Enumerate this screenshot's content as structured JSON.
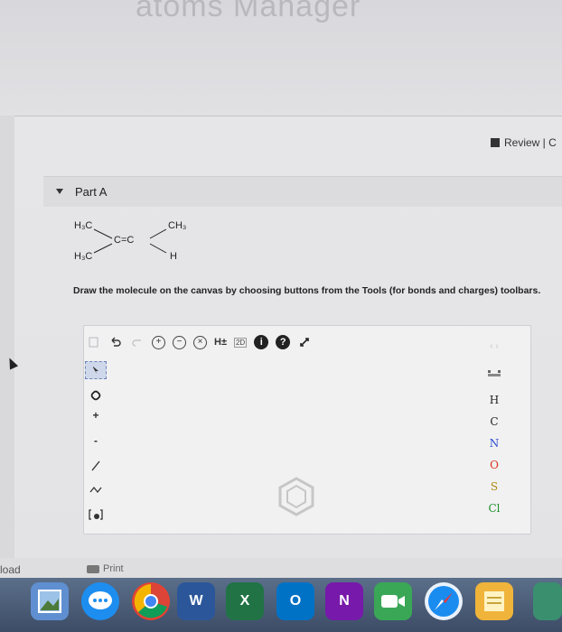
{
  "page": {
    "ghost_title": "atoms Manager"
  },
  "header": {
    "review_label": "Review | C"
  },
  "part": {
    "title": "Part A"
  },
  "molecule": {
    "h3c_top": "H₃C",
    "ch3": "CH₃",
    "double_bond": "C=C",
    "h3c_bottom": "H₃C",
    "h": "H"
  },
  "instructions": "Draw the molecule on the canvas by choosing buttons from the Tools (for bonds and charges) toolbars.",
  "top_toolbar": {
    "icons": [
      "copy-icon",
      "undo-icon",
      "redo-icon",
      "zoom-in-icon",
      "zoom-out-icon",
      "clear-icon",
      "hydrogen-toggle-icon",
      "2d-view-icon",
      "info-icon",
      "help-icon",
      "expand-icon"
    ],
    "hydrogen_label": "H±",
    "two_d_label": "2D",
    "info_label": "i",
    "help_label": "?"
  },
  "left_toolbar": {
    "plus_label": "+",
    "minus_label": "-"
  },
  "elements": [
    "H",
    "C",
    "N",
    "O",
    "S",
    "Cl"
  ],
  "element_colors": {
    "H": "#222222",
    "C": "#222222",
    "N": "#2b4bd0",
    "O": "#d9361e",
    "S": "#b08a10",
    "Cl": "#1f8f2e"
  },
  "bottom": {
    "upload_label": "load",
    "print_label": "Print"
  },
  "dock": {
    "word_label": "W",
    "excel_label": "X",
    "outlook_label": "O",
    "onenote_label": "N"
  }
}
